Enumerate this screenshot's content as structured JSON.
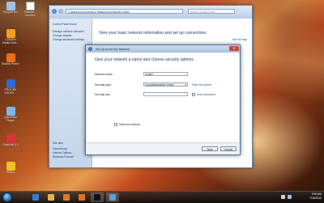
{
  "desktop": {
    "icons": [
      {
        "label": "Recycle Bin",
        "icon": "recycle-bin-icon",
        "color": "#9fc3e8"
      },
      {
        "label": "COWON Media Cent...",
        "icon": "cowon-icon",
        "color": "#f0a020"
      },
      {
        "label": "Mozilla Firefox",
        "icon": "firefox-icon",
        "color": "#e8701a"
      },
      {
        "label": "PROLINK HSDPA ...",
        "icon": "prolink-icon",
        "color": "#2d6bd1"
      },
      {
        "label": "QuickTime Player",
        "icon": "quicktime-icon",
        "color": "#7ab8e8"
      },
      {
        "label": "FlashGet 3.3",
        "icon": "flashget-icon",
        "color": "#d93535"
      },
      {
        "label": "History",
        "icon": "history-icon",
        "color": "#f0c020"
      }
    ],
    "second_column": [
      {
        "label": "Pasoftar - Shortcut",
        "icon": "shortcut-icon",
        "color": "#ffffff"
      }
    ]
  },
  "control_panel": {
    "address": "« Network and Internet ▸ Network and Sharing Center",
    "search_placeholder": "Search Control Panel",
    "sidebar": [
      {
        "label": "Control Panel Home"
      },
      {
        "label": "Manage wireless networks"
      },
      {
        "label": "Change adapter"
      },
      {
        "label": "Change advanced settings"
      }
    ],
    "see_also": {
      "header": "See also",
      "items": [
        "HomeGroup",
        "Internet Options",
        "Windows Firewall"
      ]
    },
    "heading": "View your basic network information and set up connections",
    "see_full_map": "See full map"
  },
  "wizard": {
    "title": "Set Up an Ad Hoc Network",
    "heading": "Give your network a name and choose security options",
    "fields": {
      "network_name": {
        "label": "Network name:",
        "value": "testfull"
      },
      "security_type": {
        "label": "Security type:",
        "value": "No authentication (Open)"
      },
      "security_key": {
        "label": "Security key:",
        "value": ""
      }
    },
    "help_link": "Help me choose",
    "hide_characters": "Hide characters",
    "save_network": "Save this network",
    "buttons": {
      "next": "Next",
      "cancel": "Cancel"
    }
  },
  "taskbar": {
    "apps": [
      {
        "icon": "ie-icon",
        "color": "#2f7fd8"
      },
      {
        "icon": "explorer-icon",
        "color": "#e2b443"
      },
      {
        "icon": "media-player-icon",
        "color": "#e37a1f"
      },
      {
        "icon": "firefox-icon",
        "color": "#e8701a"
      },
      {
        "icon": "command-prompt-icon",
        "color": "#111111"
      },
      {
        "icon": "control-panel-icon",
        "color": "#5aa0d8"
      }
    ],
    "time": "9:00 AM",
    "date": "7/16/2010"
  }
}
